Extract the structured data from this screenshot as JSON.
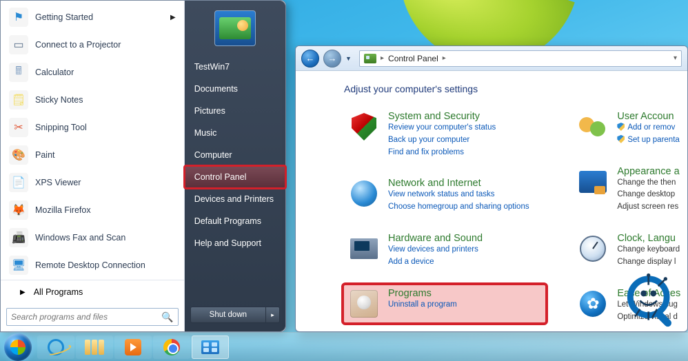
{
  "start_menu": {
    "programs": [
      {
        "label": "Getting Started",
        "icon": "flag-icon",
        "has_submenu": true,
        "color": "#2a8ad4"
      },
      {
        "label": "Connect to a Projector",
        "icon": "projector-icon",
        "color": "#5a708b"
      },
      {
        "label": "Calculator",
        "icon": "calculator-icon",
        "color": "#8aa6c6"
      },
      {
        "label": "Sticky Notes",
        "icon": "sticky-notes-icon",
        "color": "#f2d94b"
      },
      {
        "label": "Snipping Tool",
        "icon": "scissors-icon",
        "color": "#e05a3a"
      },
      {
        "label": "Paint",
        "icon": "paint-icon",
        "color": "#e8b24a"
      },
      {
        "label": "XPS Viewer",
        "icon": "xps-icon",
        "color": "#2a8ad4"
      },
      {
        "label": "Mozilla Firefox",
        "icon": "firefox-icon",
        "color": "#ff8a00"
      },
      {
        "label": "Windows Fax and Scan",
        "icon": "fax-icon",
        "color": "#5a708b"
      },
      {
        "label": "Remote Desktop Connection",
        "icon": "rdp-icon",
        "color": "#2a8ad4"
      }
    ],
    "all_programs_label": "All Programs",
    "search_placeholder": "Search programs and files",
    "right_links": [
      {
        "label": "TestWin7",
        "highlight": false
      },
      {
        "label": "Documents",
        "highlight": false
      },
      {
        "label": "Pictures",
        "highlight": false
      },
      {
        "label": "Music",
        "highlight": false
      },
      {
        "label": "Computer",
        "highlight": false
      },
      {
        "label": "Control Panel",
        "highlight": true
      },
      {
        "label": "Devices and Printers",
        "highlight": false
      },
      {
        "label": "Default Programs",
        "highlight": false
      },
      {
        "label": "Help and Support",
        "highlight": false
      }
    ],
    "shutdown_label": "Shut down"
  },
  "control_panel": {
    "breadcrumb": [
      "Control Panel"
    ],
    "heading": "Adjust your computer's settings",
    "left_categories": [
      {
        "title": "System and Security",
        "links": [
          "Review your computer's status",
          "Back up your computer",
          "Find and fix problems"
        ],
        "icon": "shield"
      },
      {
        "title": "Network and Internet",
        "links": [
          "View network status and tasks",
          "Choose homegroup and sharing options"
        ],
        "icon": "net"
      },
      {
        "title": "Hardware and Sound",
        "links": [
          "View devices and printers",
          "Add a device"
        ],
        "icon": "hw"
      },
      {
        "title": "Programs",
        "links": [
          "Uninstall a program"
        ],
        "icon": "prog",
        "highlight": true
      }
    ],
    "right_categories": [
      {
        "title": "User Accoun",
        "links": [
          "Add or remov",
          "Set up parenta"
        ],
        "icon": "users",
        "shield": true
      },
      {
        "title": "Appearance a",
        "sub": [
          "Change the then",
          "Change desktop",
          "Adjust screen res"
        ],
        "icon": "appr"
      },
      {
        "title": "Clock, Langu",
        "sub": [
          "Change keyboard",
          "Change display l"
        ],
        "icon": "clock"
      },
      {
        "title": "Ease of Acces",
        "sub": [
          "Let Windows sug",
          "Optimize visual d"
        ],
        "icon": "ease"
      }
    ]
  },
  "taskbar": {
    "pinned": [
      {
        "name": "ie-icon"
      },
      {
        "name": "explorer-icon"
      },
      {
        "name": "media-player-icon"
      },
      {
        "name": "chrome-icon"
      },
      {
        "name": "control-panel-icon",
        "active": true
      }
    ]
  }
}
